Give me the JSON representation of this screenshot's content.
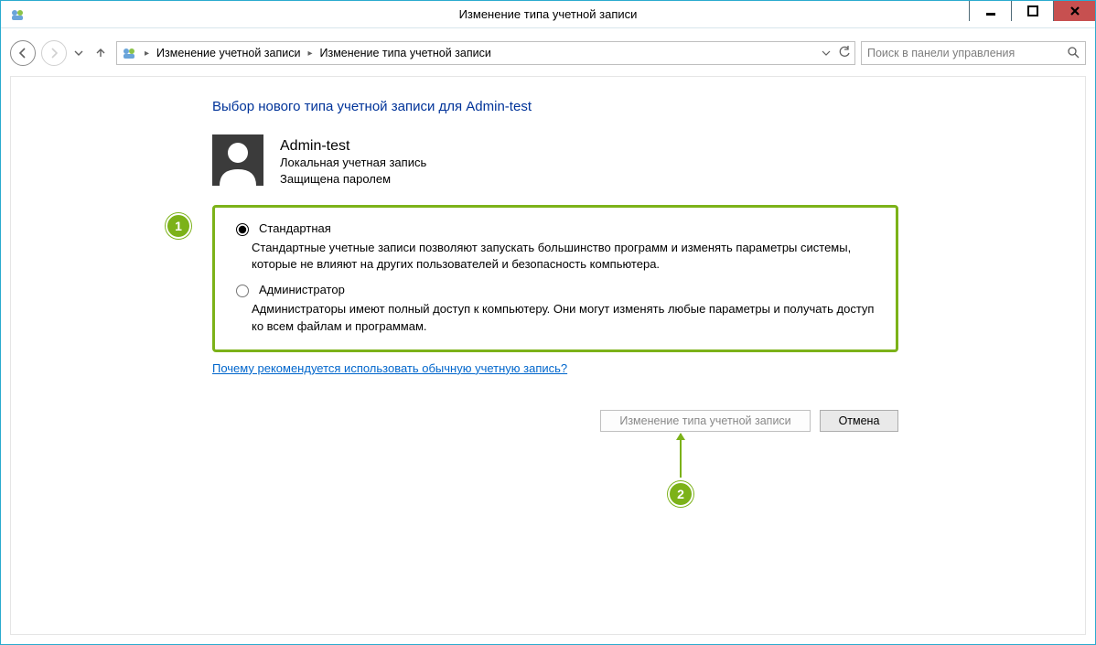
{
  "window": {
    "title": "Изменение типа учетной записи"
  },
  "breadcrumb": {
    "seg1": "Изменение учетной записи",
    "seg2": "Изменение типа учетной записи"
  },
  "search": {
    "placeholder": "Поиск в панели управления"
  },
  "page": {
    "heading": "Выбор нового типа учетной записи для Admin-test"
  },
  "user": {
    "name": "Admin-test",
    "line1": "Локальная учетная запись",
    "line2": "Защищена паролем"
  },
  "options": {
    "standard": {
      "label": "Стандартная",
      "desc": "Стандартные учетные записи позволяют запускать большинство программ и изменять параметры системы, которые не влияют на других пользователей и безопасность компьютера."
    },
    "admin": {
      "label": "Администратор",
      "desc": "Администраторы имеют полный доступ к компьютеру. Они могут изменять любые параметры и получать доступ ко всем файлам и программам."
    }
  },
  "link_why": "Почему рекомендуется использовать обычную учетную запись?",
  "buttons": {
    "change": "Изменение типа учетной записи",
    "cancel": "Отмена"
  },
  "annotations": {
    "step1": "1",
    "step2": "2"
  }
}
